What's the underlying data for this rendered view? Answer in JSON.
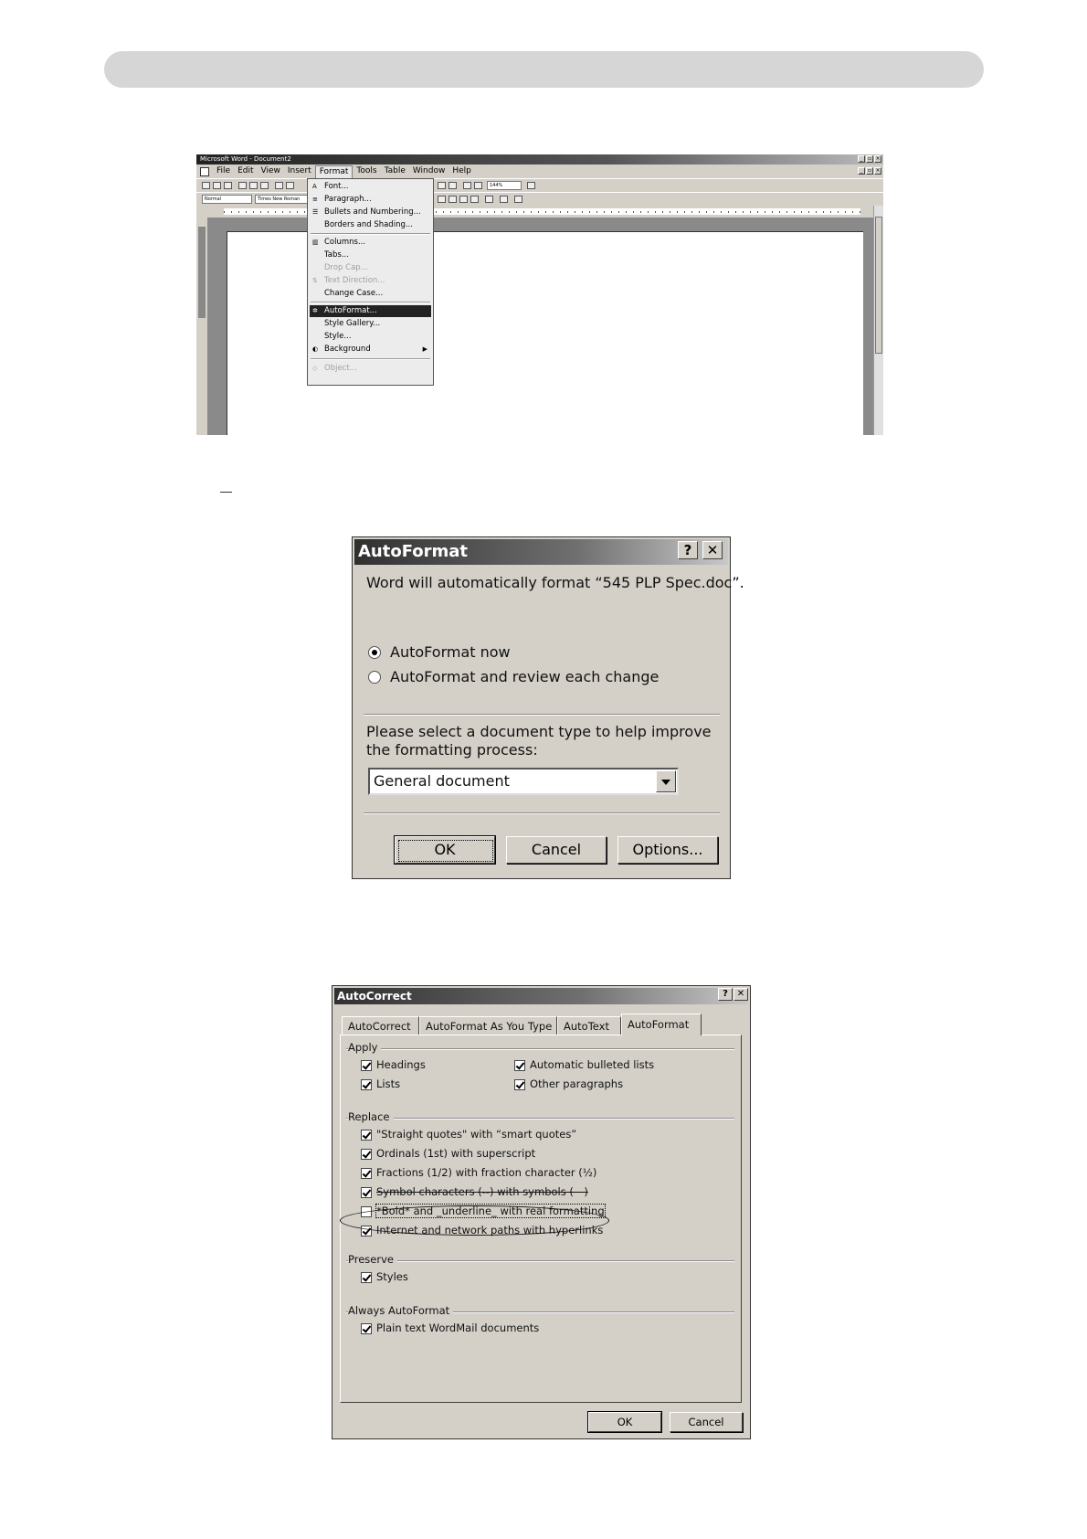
{
  "word": {
    "title": "Microsoft Word - Document2",
    "menu": [
      "File",
      "Edit",
      "View",
      "Insert",
      "Format",
      "Tools",
      "Table",
      "Window",
      "Help"
    ],
    "style_combo": "Normal",
    "font_combo": "Times New Roman",
    "zoom": "144%",
    "format_menu": {
      "font": "Font...",
      "paragraph": "Paragraph...",
      "bullets": "Bullets and Numbering...",
      "borders": "Borders and Shading...",
      "columns": "Columns...",
      "tabs": "Tabs...",
      "drop_cap": "Drop Cap...",
      "text_direction": "Text Direction...",
      "change_case": "Change Case...",
      "autoformat": "AutoFormat...",
      "style_gallery": "Style Gallery...",
      "style": "Style...",
      "background": "Background",
      "object": "Object..."
    }
  },
  "autoformat_dialog": {
    "title": "AutoFormat",
    "help_glyph": "?",
    "close_glyph": "✕",
    "message": "Word will automatically format “545 PLP Spec.doc”.",
    "radio_now": "AutoFormat now",
    "radio_review": "AutoFormat and review each change",
    "doc_type_prompt_1": "Please select a document type to help improve",
    "doc_type_prompt_2": "the formatting process:",
    "doc_type_value": "General document",
    "ok": "OK",
    "cancel": "Cancel",
    "options": "Options..."
  },
  "autocorrect_dialog": {
    "title": "AutoCorrect",
    "help_glyph": "?",
    "close_glyph": "✕",
    "tabs": [
      "AutoCorrect",
      "AutoFormat As You Type",
      "AutoText",
      "AutoFormat"
    ],
    "apply": {
      "label": "Apply",
      "headings": "Headings",
      "lists": "Lists",
      "bulleted": "Automatic bulleted lists",
      "other": "Other paragraphs"
    },
    "replace": {
      "label": "Replace",
      "quotes": "\"Straight quotes\" with “smart quotes”",
      "ordinals": "Ordinals (1st) with superscript",
      "fractions": "Fractions (1/2) with fraction character (½)",
      "symbols": "Symbol characters (--) with symbols (—)",
      "bold": "*Bold* and _underline_ with real formatting",
      "internet": "Internet and network paths with hyperlinks"
    },
    "preserve": {
      "label": "Preserve",
      "styles": "Styles"
    },
    "always": {
      "label": "Always AutoFormat",
      "plain": "Plain text WordMail documents"
    },
    "ok": "OK",
    "cancel": "Cancel"
  }
}
